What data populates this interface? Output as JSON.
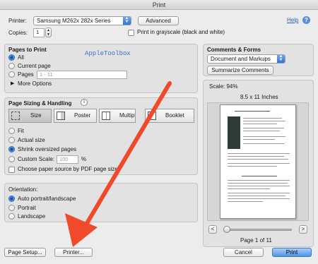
{
  "window": {
    "title": "Print"
  },
  "printer": {
    "label": "Printer:",
    "value": "Samsung M262x 282x Series",
    "advanced_label": "Advanced",
    "help_label": "Help"
  },
  "copies": {
    "label": "Copies:",
    "value": "1",
    "grayscale_label": "Print in grayscale (black and white)"
  },
  "pages_to_print": {
    "title": "Pages to Print",
    "watermark": "AppleToolbox",
    "options": [
      {
        "label": "All",
        "selected": true
      },
      {
        "label": "Current page",
        "selected": false
      },
      {
        "label": "Pages",
        "selected": false
      }
    ],
    "pages_placeholder": "1 - 11",
    "more_options_label": "More Options"
  },
  "sizing": {
    "title": "Page Sizing & Handling",
    "tabs": [
      "Size",
      "Poster",
      "Multiple",
      "Booklet"
    ],
    "options": [
      {
        "label": "Fit",
        "selected": false
      },
      {
        "label": "Actual size",
        "selected": false
      },
      {
        "label": "Shrink oversized pages",
        "selected": true
      },
      {
        "label": "Custom Scale:",
        "selected": false
      }
    ],
    "scale_value": "100",
    "scale_unit": "%",
    "paper_source_label": "Choose paper source by PDF page size"
  },
  "orientation": {
    "title": "Orientation:",
    "options": [
      {
        "label": "Auto portrait/landscape",
        "selected": true
      },
      {
        "label": "Portrait",
        "selected": false
      },
      {
        "label": "Landscape",
        "selected": false
      }
    ]
  },
  "comments": {
    "title": "Comments & Forms",
    "value": "Document and Markups",
    "summarize_label": "Summarize Comments"
  },
  "preview": {
    "scale_label": "Scale:  94%",
    "paper_size": "8.5 x 11 Inches",
    "page_indicator": "Page 1 of 11",
    "prev_label": "<",
    "next_label": ">"
  },
  "footer": {
    "page_setup_label": "Page Setup...",
    "printer_label": "Printer...",
    "cancel_label": "Cancel",
    "print_label": "Print"
  },
  "colors": {
    "accent": "#3f80dd",
    "arrow": "#f04a2a",
    "watermark": "#3a6fd8"
  }
}
